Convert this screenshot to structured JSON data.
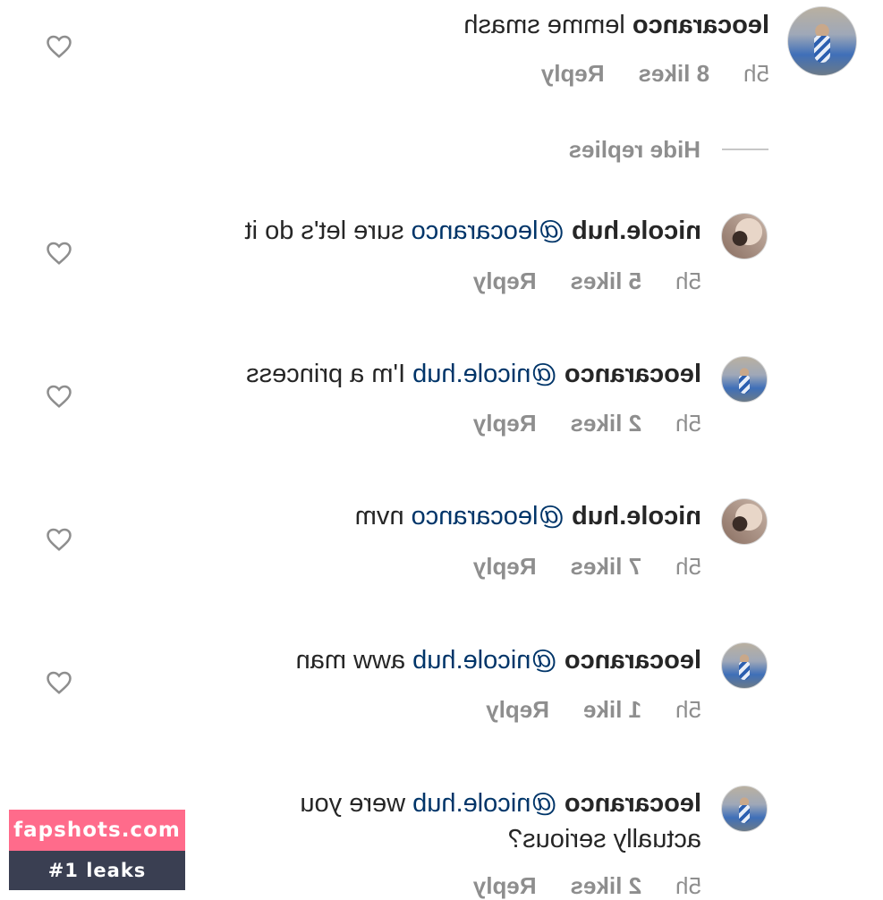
{
  "comments": [
    {
      "username": "leocaranco",
      "mention": "",
      "text": "lemme smash",
      "time": "5h",
      "likes": "8 likes",
      "reply": "Reply",
      "avatar": "leo"
    },
    {
      "username": "nicole.hub",
      "mention": "@leocaranco",
      "text": "sure let's do it",
      "time": "5h",
      "likes": "5 likes",
      "reply": "Reply",
      "avatar": "nicole"
    },
    {
      "username": "leocaranco",
      "mention": "@nicole.hub",
      "text": "I'm a princess",
      "time": "5h",
      "likes": "2 likes",
      "reply": "Reply",
      "avatar": "leo"
    },
    {
      "username": "nicole.hub",
      "mention": "@leocaranco",
      "text": "nvm",
      "time": "5h",
      "likes": "7 likes",
      "reply": "Reply",
      "avatar": "nicole"
    },
    {
      "username": "leocaranco",
      "mention": "@nicole.hub",
      "text": "aww man",
      "time": "5h",
      "likes": "1 like",
      "reply": "Reply",
      "avatar": "leo"
    },
    {
      "username": "leocaranco",
      "mention": "@nicole.hub",
      "text": "were you",
      "text2": "actually serious?",
      "time": "5h",
      "likes": "2 likes",
      "reply": "Reply",
      "avatar": "leo"
    }
  ],
  "hide_replies_label": "Hide replies",
  "watermark": {
    "site": "fapshots.com",
    "tagline": "#1 leaks"
  },
  "icons": {
    "heart": "heart-icon"
  },
  "colors": {
    "text": "#262626",
    "meta": "#8e8e8e",
    "mention": "#003569",
    "watermark_pink": "#ff6b8b",
    "watermark_dark": "#3a3f52"
  }
}
